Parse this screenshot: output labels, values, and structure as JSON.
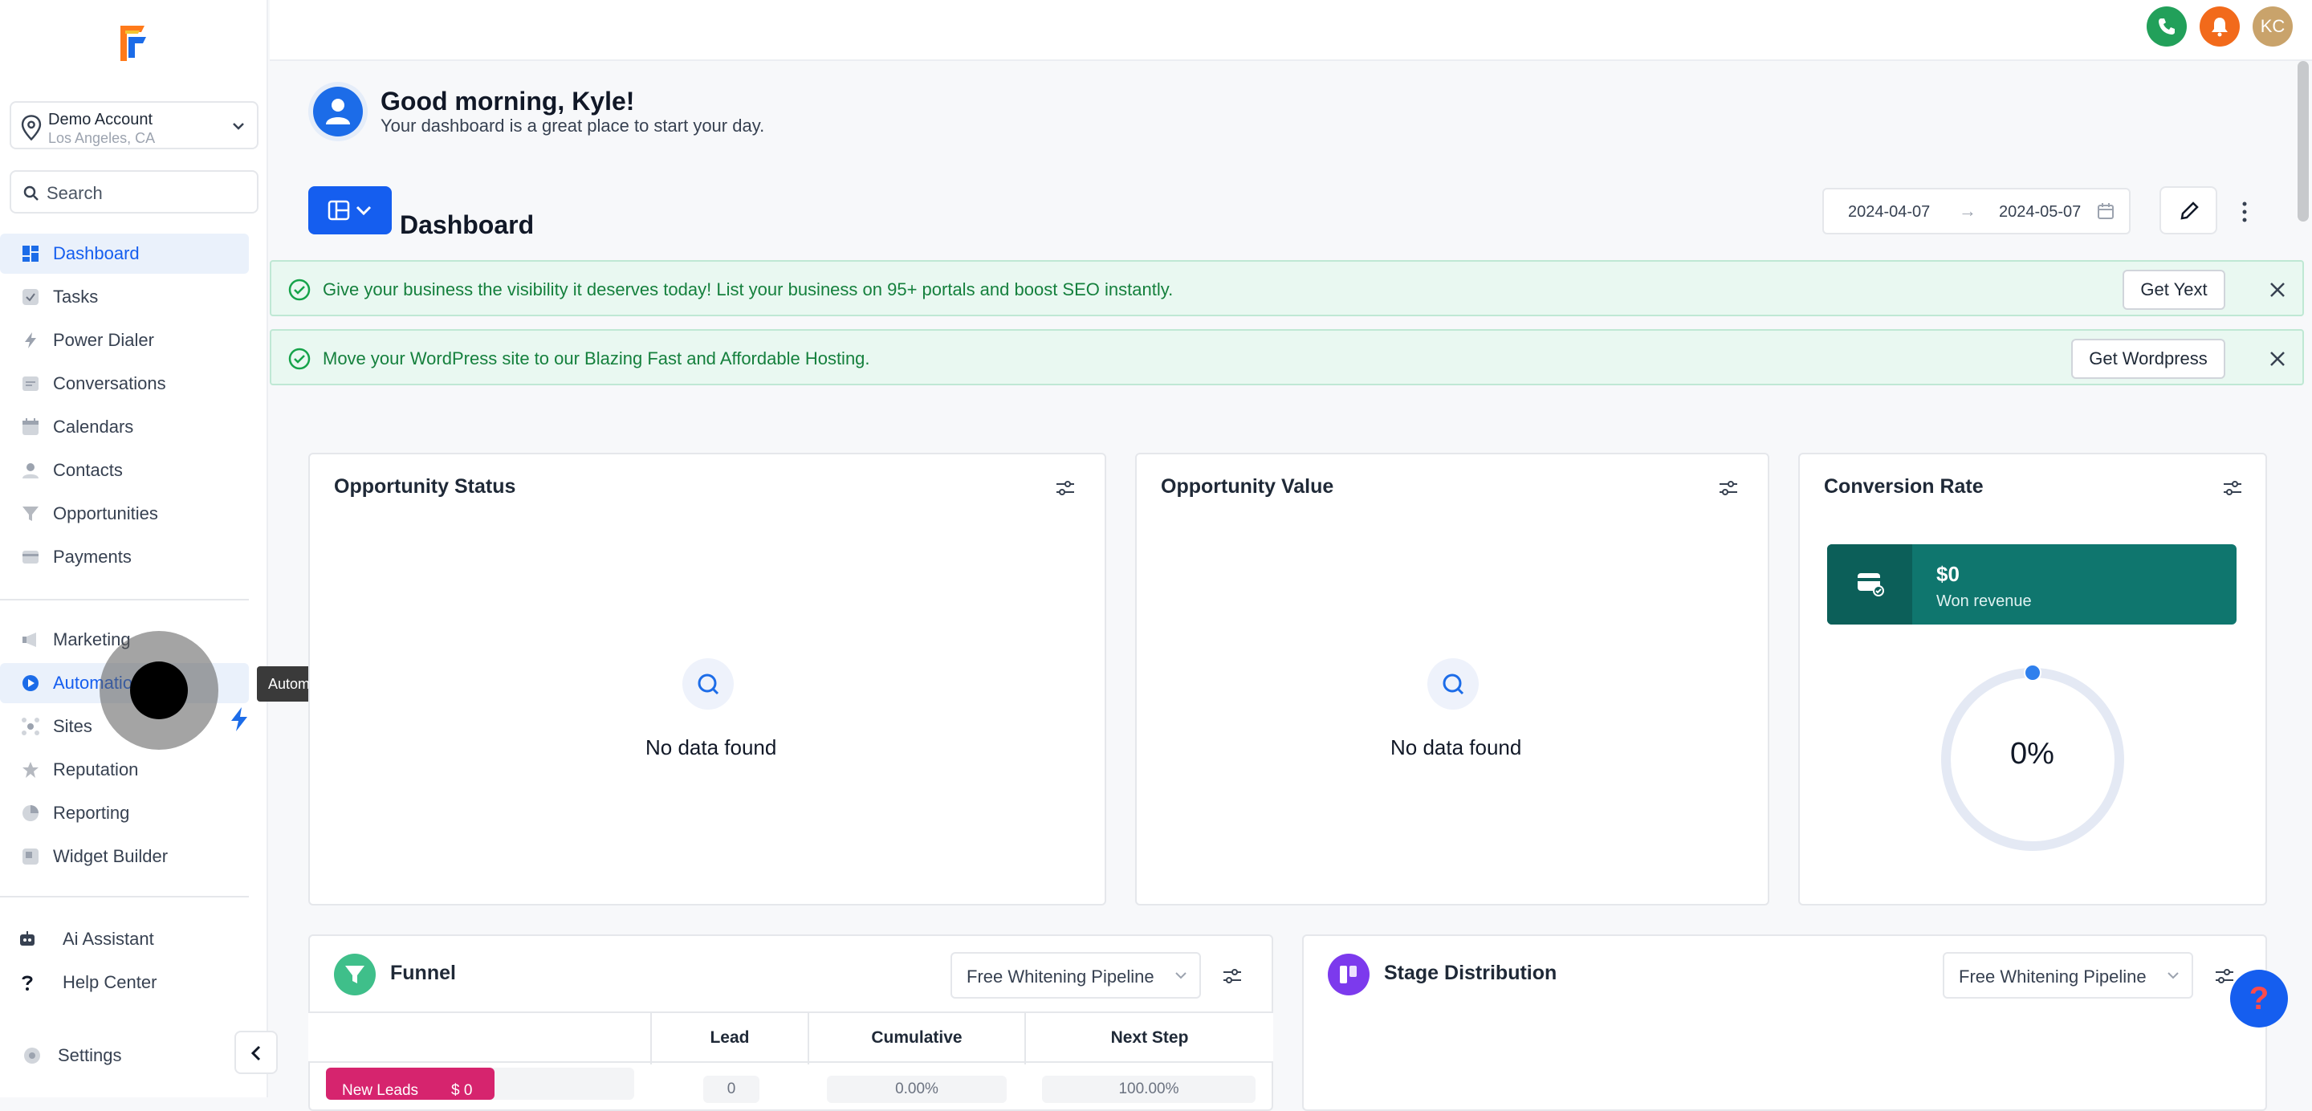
{
  "account": {
    "name": "Demo Account",
    "location": "Los Angeles, CA"
  },
  "search": {
    "placeholder": "Search"
  },
  "sidebar": {
    "primary": [
      {
        "label": "Dashboard",
        "icon": "dashboard-icon",
        "active": true
      },
      {
        "label": "Tasks",
        "icon": "check-icon"
      },
      {
        "label": "Power Dialer",
        "icon": "power-dialer-icon"
      },
      {
        "label": "Conversations",
        "icon": "chat-icon"
      },
      {
        "label": "Calendars",
        "icon": "calendar-icon"
      },
      {
        "label": "Contacts",
        "icon": "person-icon"
      },
      {
        "label": "Opportunities",
        "icon": "funnel-icon"
      },
      {
        "label": "Payments",
        "icon": "card-icon"
      }
    ],
    "secondary": [
      {
        "label": "Marketing",
        "icon": "megaphone-icon"
      },
      {
        "label": "Automation",
        "icon": "automation-icon",
        "active": true
      },
      {
        "label": "Sites",
        "icon": "sites-icon"
      },
      {
        "label": "Reputation",
        "icon": "star-icon"
      },
      {
        "label": "Reporting",
        "icon": "pie-icon"
      },
      {
        "label": "Widget Builder",
        "icon": "widget-icon"
      }
    ],
    "bottom": [
      {
        "label": "Ai Assistant",
        "icon": "robot-icon"
      },
      {
        "label": "Help Center",
        "icon": "question-icon"
      },
      {
        "label": "Settings",
        "icon": "gear-icon"
      }
    ],
    "tooltip": "Automation"
  },
  "topbar": {
    "avatar_initials": "KC",
    "accent_call": "#22a05a",
    "accent_notify": "#f26a1b",
    "accent_avatar": "#c9a36b"
  },
  "greeting": {
    "title": "Good morning, Kyle!",
    "subtitle": "Your dashboard is a great place to start your day."
  },
  "dashboard": {
    "title": "Dashboard",
    "date_start": "2024-04-07",
    "date_end": "2024-05-07"
  },
  "banners": [
    {
      "text": "Give your business the visibility it deserves today! List your business on 95+ portals and boost SEO instantly.",
      "button": "Get Yext"
    },
    {
      "text": "Move your WordPress site to our Blazing Fast and Affordable Hosting.",
      "button": "Get Wordpress"
    }
  ],
  "cards": {
    "opportunity_status": {
      "title": "Opportunity Status",
      "empty": "No data found"
    },
    "opportunity_value": {
      "title": "Opportunity Value",
      "empty": "No data found"
    },
    "conversion_rate": {
      "title": "Conversion Rate",
      "revenue_value": "$0",
      "revenue_label": "Won revenue",
      "rate": "0%",
      "rate_fraction": 0
    },
    "funnel": {
      "title": "Funnel",
      "pipeline": "Free Whitening Pipeline",
      "columns": [
        "Lead",
        "Cumulative",
        "Next Step"
      ],
      "rows": [
        {
          "stage": "New Leads",
          "value": "$ 0",
          "lead": "0",
          "cumulative": "0.00%",
          "next_step": "100.00%"
        }
      ]
    },
    "stage_distribution": {
      "title": "Stage Distribution",
      "pipeline": "Free Whitening Pipeline"
    }
  },
  "help_fab": "?"
}
